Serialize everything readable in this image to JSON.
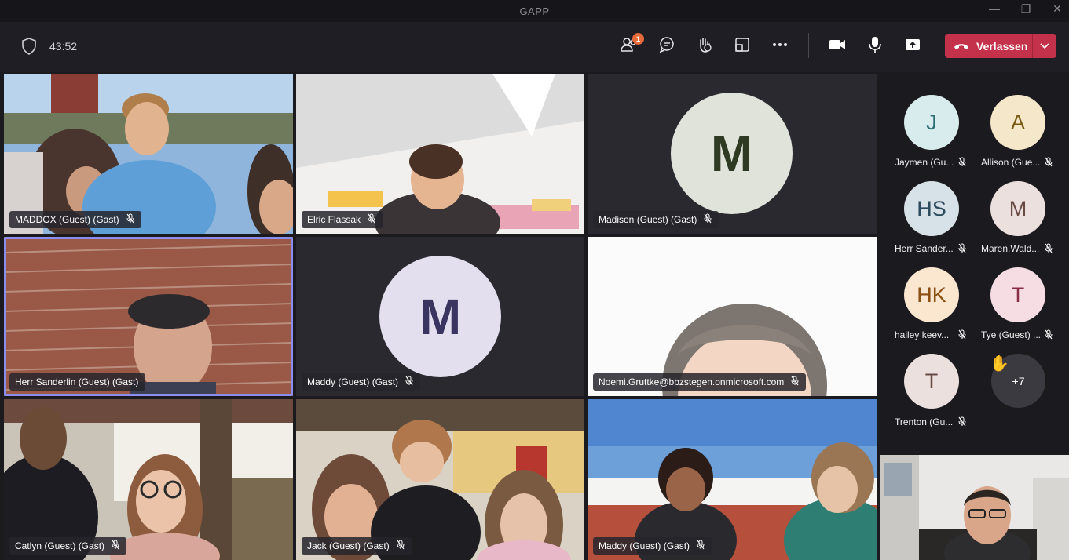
{
  "window": {
    "title": "GAPP",
    "minimize": "—",
    "maximize": "❐",
    "close": "✕"
  },
  "toolbar": {
    "timer": "43:52",
    "people_badge": "1",
    "leave_label": "Verlassen",
    "icons": [
      "shield-icon",
      "people-icon",
      "chat-icon",
      "raise-hand-icon",
      "room-view-icon",
      "more-icon",
      "camera-icon",
      "mic-icon",
      "share-icon",
      "phone-hangup-icon",
      "chevron-down-icon"
    ]
  },
  "tiles": [
    {
      "name": "MADDOX (Guest) (Gast)"
    },
    {
      "name": "Elric Flassak"
    },
    {
      "name": "Madison (Guest) (Gast)",
      "initial": "M",
      "avatar_bg": "#dfe3da",
      "avatar_fg": "#2e3a22"
    },
    {
      "name": "Herr Sanderlin (Guest) (Gast)"
    },
    {
      "name": "Maddy (Guest) (Gast)",
      "initial": "M",
      "avatar_bg": "#e3dfef",
      "avatar_fg": "#3a3560"
    },
    {
      "name": "Noemi.Gruttke@bbzstegen.onmicrosoft.com"
    },
    {
      "name": "Catlyn (Guest) (Gast)"
    },
    {
      "name": "Jack (Guest) (Gast)"
    },
    {
      "name": "Maddy (Guest) (Gast)"
    }
  ],
  "sidebar": {
    "participants": [
      {
        "initials": "J",
        "name": "Jaymen (Gu...",
        "bg": "#d8ecee",
        "fg": "#2e6f76"
      },
      {
        "initials": "A",
        "name": "Allison (Gue...",
        "bg": "#f5e7c9",
        "fg": "#7a5a13"
      },
      {
        "initials": "HS",
        "name": "Herr Sander...",
        "bg": "#d6e1e8",
        "fg": "#2c4a5c"
      },
      {
        "initials": "M",
        "name": "Maren.Wald...",
        "bg": "#ebe0de",
        "fg": "#6a4b44"
      },
      {
        "initials": "HK",
        "name": "hailey keev...",
        "bg": "#fbe6cf",
        "fg": "#8a4f12"
      },
      {
        "initials": "T",
        "name": "Tye (Guest) ...",
        "bg": "#f6dde3",
        "fg": "#8a2e45"
      },
      {
        "initials": "T",
        "name": "Trenton (Gu...",
        "bg": "#ebe0de",
        "fg": "#6a4b44"
      }
    ],
    "overflow_count": "+7",
    "hand_emoji": "✋"
  }
}
